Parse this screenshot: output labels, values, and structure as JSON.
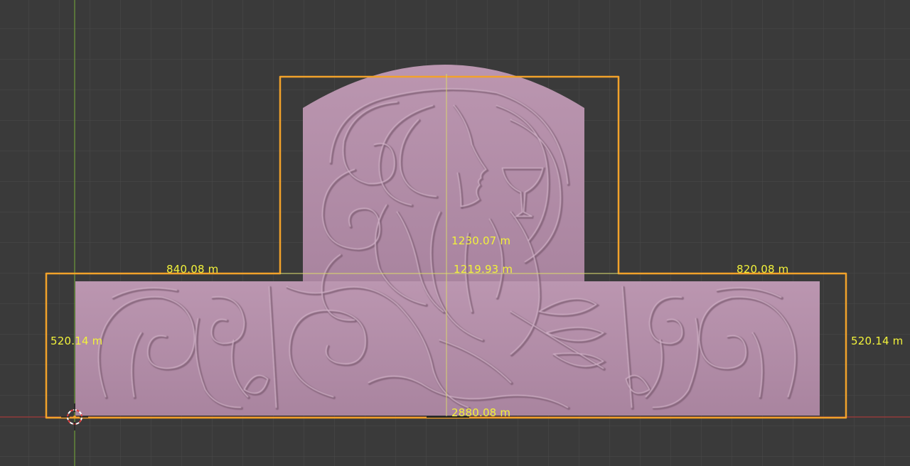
{
  "viewport": {
    "background_color": "#3a3a3a",
    "grid_color": "#4a4a4a",
    "x_axis_color": "#a33a3a",
    "y_axis_color": "#6e9a3a",
    "mesh_color": "#b48ea8",
    "outline_color": "#f2a22a",
    "measure_color": "#f2f23a"
  },
  "object": {
    "name": "relief panel",
    "content": "woman with flowing hair holding a goblet, swirl and leaf ornaments"
  },
  "measurements": {
    "top_height": "1230.07 m",
    "top_width": "1219.93 m",
    "left_width": "840.08 m",
    "right_width": "820.08 m",
    "left_height": "520.14 m",
    "right_height": "520.14 m",
    "total_width": "2880.08 m"
  },
  "cursor": {
    "icon": "3d-cursor-icon"
  }
}
